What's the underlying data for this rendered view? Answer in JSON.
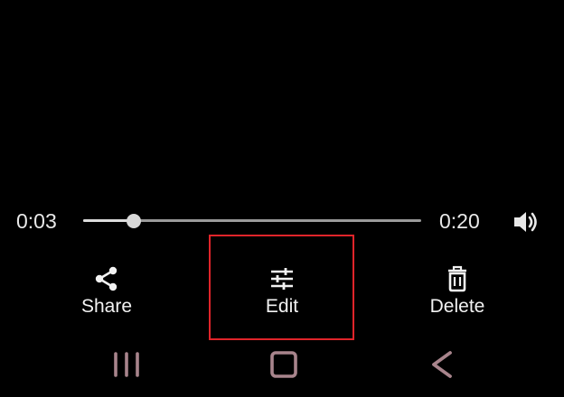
{
  "player": {
    "current_time": "0:03",
    "total_time": "0:20",
    "progress": 0.15,
    "volume_icon": "volume-icon"
  },
  "actions": {
    "share": {
      "label": "Share",
      "icon": "share-icon"
    },
    "edit": {
      "label": "Edit",
      "icon": "sliders-icon"
    },
    "delete": {
      "label": "Delete",
      "icon": "trash-icon"
    }
  },
  "nav": {
    "recents_icon": "recents-icon",
    "home_icon": "home-icon",
    "back_icon": "back-icon"
  },
  "colors": {
    "background": "#000000",
    "text": "#f2f2f2",
    "highlight": "#e0242a",
    "nav": "#a8848c"
  }
}
